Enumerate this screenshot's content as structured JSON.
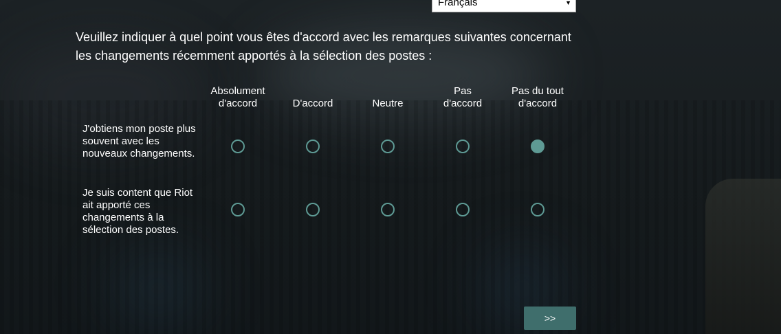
{
  "language_select": {
    "value": "Français"
  },
  "question": "Veuillez indiquer à quel point vous êtes d'accord avec les remarques suivantes concernant les changements récemment apportés à la sélection des postes :",
  "scale": [
    {
      "line1": "Absolument",
      "line2": "d'accord"
    },
    {
      "line1": "",
      "line2": "D'accord"
    },
    {
      "line1": "",
      "line2": "Neutre"
    },
    {
      "line1": "Pas",
      "line2": "d'accord"
    },
    {
      "line1": "Pas du tout",
      "line2": "d'accord"
    }
  ],
  "statements": [
    {
      "label": "J'obtiens mon poste plus souvent avec les nouveaux changements.",
      "selected": 4
    },
    {
      "label": "Je suis content que Riot ait apporté ces changements à la sélection des postes.",
      "selected": null
    }
  ],
  "next_button": ">>",
  "accent_color": "#5e9a94"
}
